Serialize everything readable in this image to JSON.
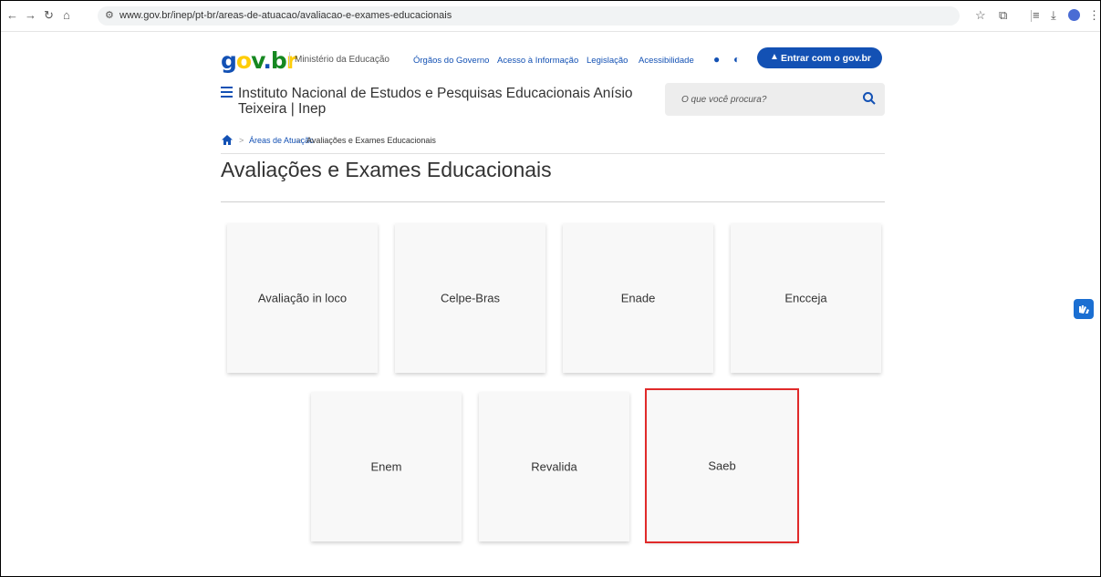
{
  "browser": {
    "url": "www.gov.br/inep/pt-br/areas-de-atuacao/avaliacao-e-exames-educacionais"
  },
  "header": {
    "logo_text": "gov.br",
    "ministry": "Ministério da Educação",
    "links": [
      "Órgãos do Governo",
      "Acesso à Informação",
      "Legislação",
      "Acessibilidade"
    ],
    "login_label": "Entrar com o gov.br",
    "site_title": "Instituto Nacional de Estudos e Pesquisas Educacionais Anísio Teixeira | Inep",
    "search_placeholder": "O que você procura?"
  },
  "breadcrumb": {
    "items": [
      "Áreas de Atuação",
      "Avaliações e Exames Educacionais"
    ]
  },
  "page": {
    "title": "Avaliações e Exames Educacionais"
  },
  "cards": [
    {
      "label": "Avaliação in loco"
    },
    {
      "label": "Celpe-Bras"
    },
    {
      "label": "Enade"
    },
    {
      "label": "Encceja"
    },
    {
      "label": "Enem"
    },
    {
      "label": "Revalida"
    },
    {
      "label": "Saeb",
      "selected": true
    }
  ],
  "colors": {
    "brand_blue": "#1351b4",
    "highlight_red": "#e02a2a"
  }
}
